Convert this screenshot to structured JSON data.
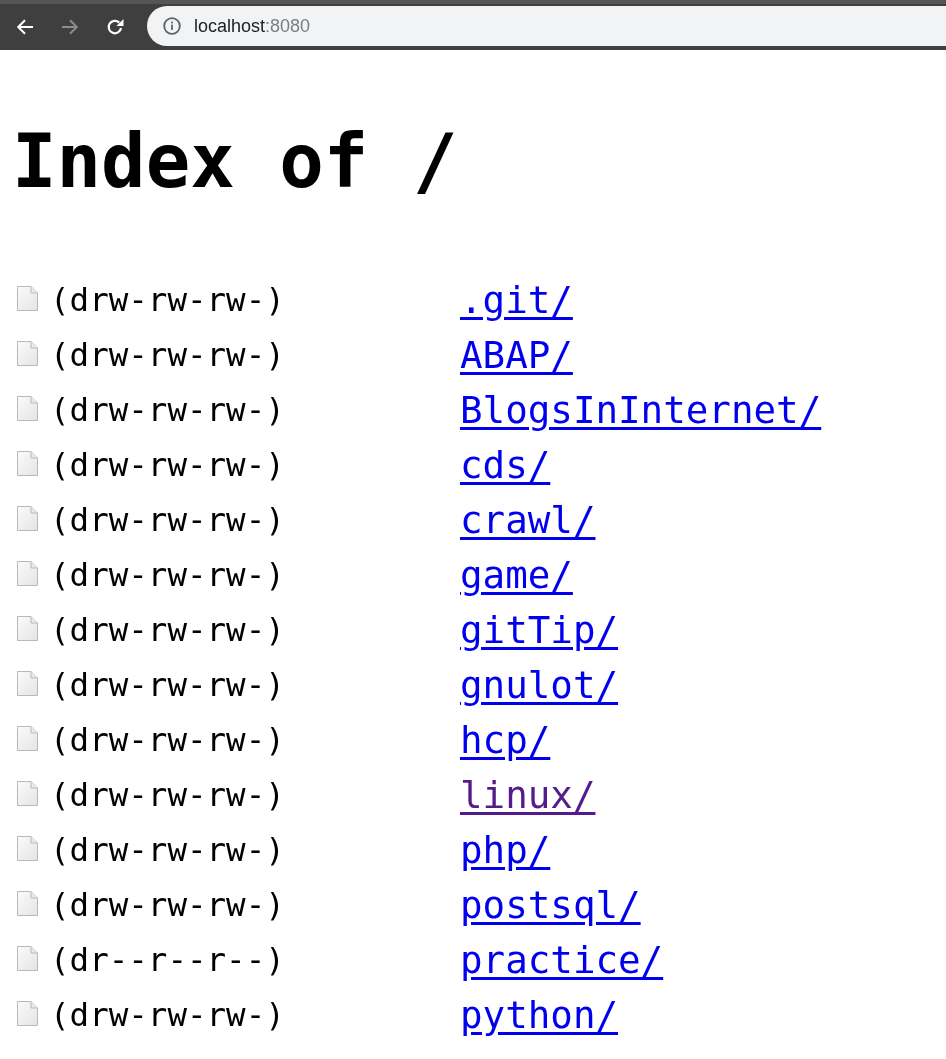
{
  "toolbar": {
    "nav_buttons": [
      {
        "kind": "back",
        "disabled": false
      },
      {
        "kind": "forward",
        "disabled": true
      },
      {
        "kind": "reload",
        "disabled": false
      }
    ],
    "address": {
      "host": "localhost",
      "port": ":8080"
    }
  },
  "heading": "Index of /",
  "entries": [
    {
      "permissions": "(drw-rw-rw-)",
      "name": ".git/",
      "visited": false
    },
    {
      "permissions": "(drw-rw-rw-)",
      "name": "ABAP/",
      "visited": false
    },
    {
      "permissions": "(drw-rw-rw-)",
      "name": "BlogsInInternet/",
      "visited": false
    },
    {
      "permissions": "(drw-rw-rw-)",
      "name": "cds/",
      "visited": false
    },
    {
      "permissions": "(drw-rw-rw-)",
      "name": "crawl/",
      "visited": false
    },
    {
      "permissions": "(drw-rw-rw-)",
      "name": "game/",
      "visited": false
    },
    {
      "permissions": "(drw-rw-rw-)",
      "name": "gitTip/",
      "visited": false
    },
    {
      "permissions": "(drw-rw-rw-)",
      "name": "gnulot/",
      "visited": false
    },
    {
      "permissions": "(drw-rw-rw-)",
      "name": "hcp/",
      "visited": false
    },
    {
      "permissions": "(drw-rw-rw-)",
      "name": "linux/",
      "visited": true
    },
    {
      "permissions": "(drw-rw-rw-)",
      "name": "php/",
      "visited": false
    },
    {
      "permissions": "(drw-rw-rw-)",
      "name": "postsql/",
      "visited": false
    },
    {
      "permissions": "(dr--r--r--)",
      "name": "practice/",
      "visited": false
    },
    {
      "permissions": "(drw-rw-rw-)",
      "name": "python/",
      "visited": false
    }
  ]
}
